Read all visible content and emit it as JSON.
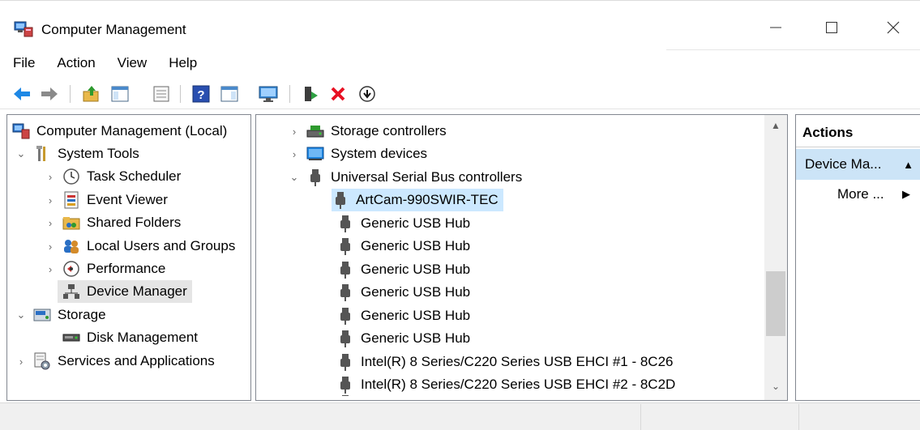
{
  "window": {
    "title": "Computer Management",
    "controls": {
      "minimize": "minimize-icon",
      "maximize": "maximize-icon",
      "close": "close-icon"
    }
  },
  "menu": [
    "File",
    "Action",
    "View",
    "Help"
  ],
  "toolbar": [
    "back-icon",
    "forward-icon",
    "up-folder-icon",
    "show-hide-tree-icon",
    "properties-icon",
    "help-icon",
    "show-hide-action-pane-icon",
    "monitor-icon",
    "update-driver-icon",
    "uninstall-icon",
    "scan-hardware-icon"
  ],
  "tree": {
    "root": "Computer Management (Local)",
    "system_tools": "System Tools",
    "task_scheduler": "Task Scheduler",
    "event_viewer": "Event Viewer",
    "shared_folders": "Shared Folders",
    "local_users": "Local Users and Groups",
    "performance": "Performance",
    "device_manager": "Device Manager",
    "storage": "Storage",
    "disk_management": "Disk Management",
    "services": "Services and Applications"
  },
  "devices": {
    "storage_controllers": "Storage controllers",
    "system_devices": "System devices",
    "usb_controllers": "Universal Serial Bus controllers",
    "usb_children": [
      "ArtCam-990SWIR-TEC",
      "Generic USB Hub",
      "Generic USB Hub",
      "Generic USB Hub",
      "Generic USB Hub",
      "Generic USB Hub",
      "Generic USB Hub",
      "Intel(R) 8 Series/C220 Series USB EHCI #1 - 8C26",
      "Intel(R) 8 Series/C220 Series USB EHCI #2 - 8C2D"
    ]
  },
  "actions": {
    "header": "Actions",
    "section": "Device Ma...",
    "more": "More ..."
  },
  "colors": {
    "selected_device": "#cce8ff",
    "selected_tree": "#e5e5e5",
    "actions_section": "#cce4f7",
    "uninstall_red": "#e81123"
  }
}
